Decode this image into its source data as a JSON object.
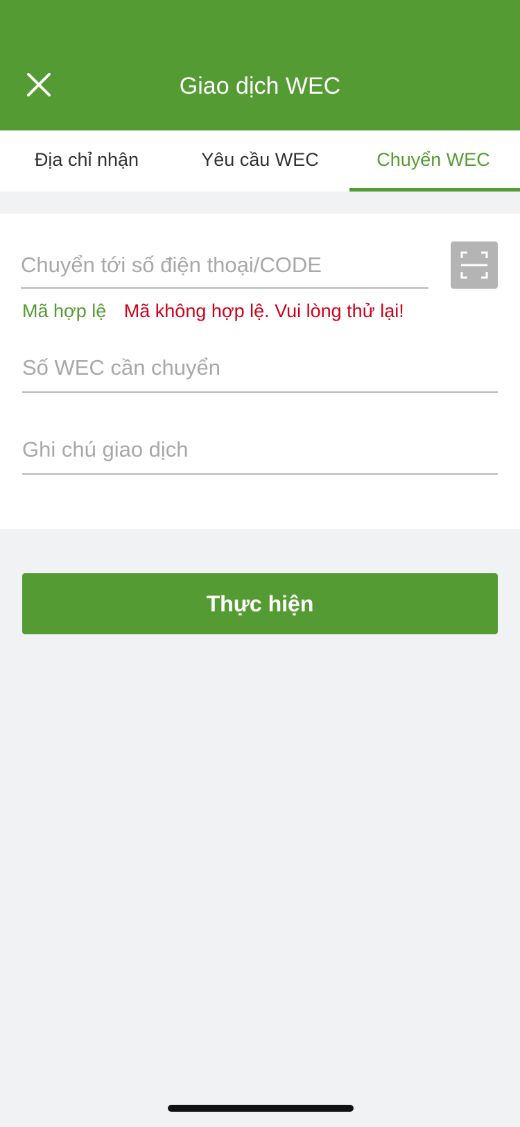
{
  "header": {
    "title": "Giao dịch WEC",
    "close_icon": "close-icon"
  },
  "tabs": [
    {
      "label": "Địa chỉ nhận",
      "active": false
    },
    {
      "label": "Yêu cầu WEC",
      "active": false
    },
    {
      "label": "Chuyển WEC",
      "active": true
    }
  ],
  "form": {
    "recipient": {
      "placeholder": "Chuyển tới số điện thoại/CODE",
      "value": ""
    },
    "scan_icon": "qr-scan-icon",
    "valid_message": "Mã hợp lệ",
    "invalid_message": "Mã không hợp lệ. Vui lòng thử lại!",
    "amount": {
      "placeholder": "Số WEC cần chuyển",
      "value": ""
    },
    "note": {
      "placeholder": "Ghi chú giao dịch",
      "value": ""
    }
  },
  "submit_label": "Thực hiện",
  "colors": {
    "primary": "#559b33",
    "error": "#d0021b",
    "background": "#f1f2f4",
    "scan_button": "#b4b4b4"
  }
}
